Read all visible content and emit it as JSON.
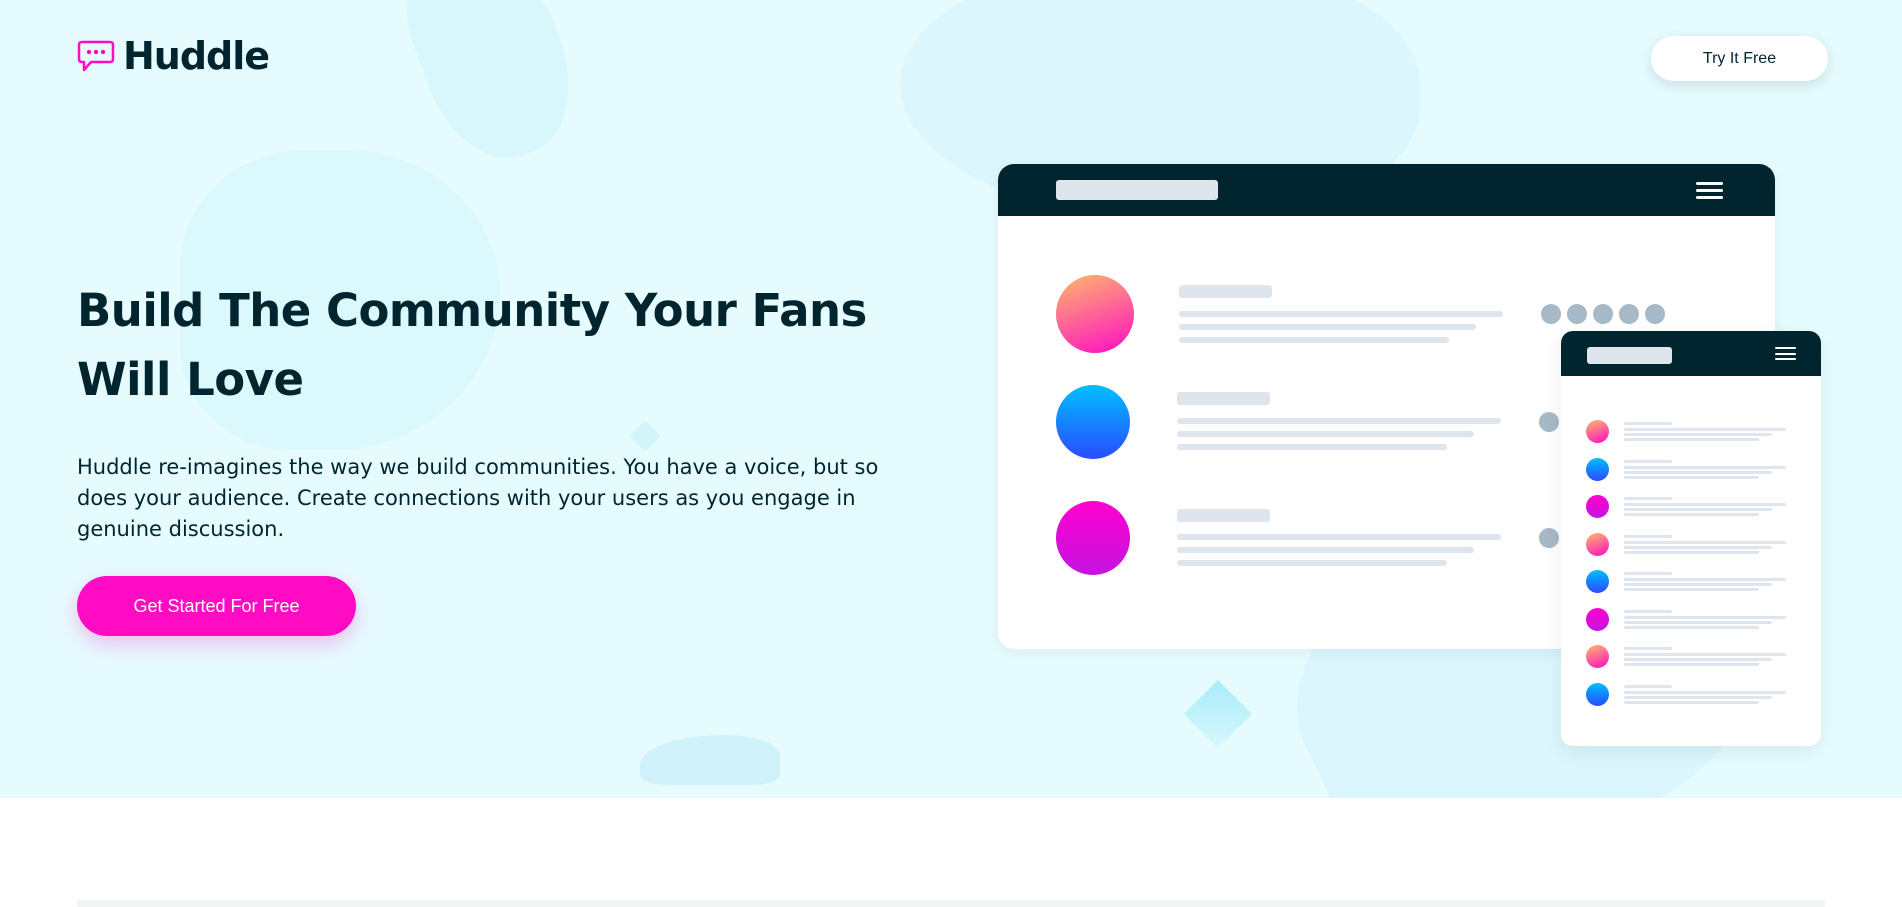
{
  "brand": {
    "name": "Huddle",
    "logo_icon": "speech-bubble-icon",
    "accent": "#ff0bc4",
    "dark": "#00252e"
  },
  "header": {
    "cta_label": "Try It Free"
  },
  "hero": {
    "title": "Build The Community Your Fans Will Love",
    "description": "Huddle re-imagines the way we build communities. You have a voice, but so does your audience. Create connections with your users as you engage in genuine discussion.",
    "cta_label": "Get Started For Free",
    "background": "#e6fbfe"
  },
  "illustration": {
    "desktop_menu_icon": "hamburger-menu-icon",
    "mobile_menu_icon": "hamburger-menu-icon"
  }
}
